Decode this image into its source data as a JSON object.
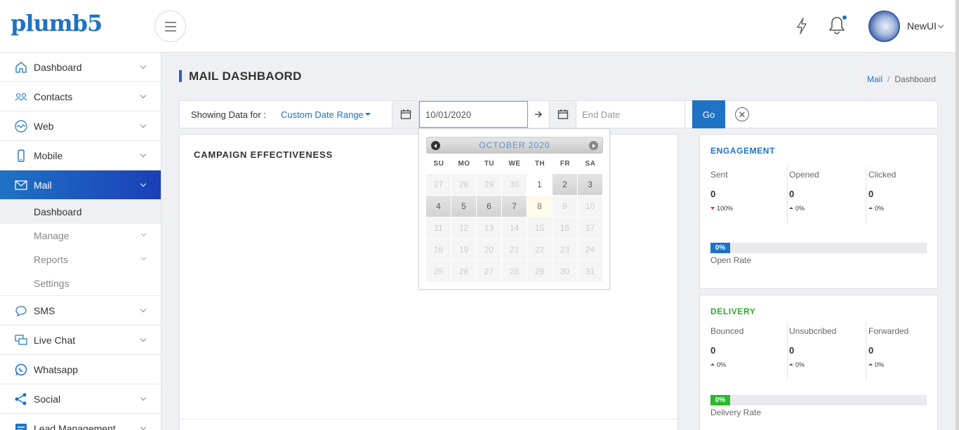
{
  "brand": {
    "logo_text": "plumb5",
    "accent": "#1e73c4",
    "active_gradient_end": "#1b3fb8"
  },
  "header": {
    "menu_icon": "hamburger-icon",
    "quick_icon": "lightning-icon",
    "notification_icon": "bell-icon",
    "user_name": "NewUI"
  },
  "sidebar": {
    "items": [
      {
        "label": "Dashboard",
        "icon": "home-icon"
      },
      {
        "label": "Contacts",
        "icon": "contacts-icon"
      },
      {
        "label": "Web",
        "icon": "web-icon"
      },
      {
        "label": "Mobile",
        "icon": "mobile-icon"
      },
      {
        "label": "Mail",
        "icon": "mail-icon"
      },
      {
        "label": "SMS",
        "icon": "chat-bubble-icon"
      },
      {
        "label": "Live Chat",
        "icon": "live-chat-icon"
      },
      {
        "label": "Whatsapp",
        "icon": "whatsapp-icon"
      },
      {
        "label": "Social",
        "icon": "share-icon"
      },
      {
        "label": "Lead Management",
        "icon": "lead-management-icon"
      }
    ],
    "mail_sub": [
      {
        "label": "Dashboard"
      },
      {
        "label": "Manage"
      },
      {
        "label": "Reports"
      },
      {
        "label": "Settings"
      }
    ]
  },
  "page": {
    "title": "MAIL DASHBAORD",
    "breadcrumb": {
      "parent": "Mail",
      "separator": "/",
      "current": "Dashboard"
    }
  },
  "filter": {
    "label": "Showing Data for :",
    "range_label": "Custom Date Range",
    "start_date": "10/01/2020",
    "end_placeholder": "End Date",
    "go_label": "Go",
    "clear_symbol": "✕"
  },
  "campaign": {
    "title": "CAMPAIGN EFFECTIVENESS"
  },
  "engagement": {
    "title": "ENGAGEMENT",
    "title_color": "#1e73c4",
    "metrics": [
      {
        "label": "Sent",
        "value": "0",
        "change": "100%",
        "direction": "down"
      },
      {
        "label": "Opened",
        "value": "0",
        "change": "0%",
        "direction": "up"
      },
      {
        "label": "Clicked",
        "value": "0",
        "change": "0%",
        "direction": "up"
      }
    ],
    "rate": {
      "value_text": "0%",
      "value": 0,
      "label": "Open Rate",
      "color": "#1e73c4"
    }
  },
  "delivery": {
    "title": "DELIVERY",
    "title_color": "#2fa82f",
    "metrics": [
      {
        "label": "Bounced",
        "value": "0",
        "change": "0%",
        "direction": "up"
      },
      {
        "label": "Unsubcribed",
        "value": "0",
        "change": "0%",
        "direction": "up"
      },
      {
        "label": "Forwarded",
        "value": "0",
        "change": "0%",
        "direction": "up"
      }
    ],
    "rate": {
      "value_text": "0%",
      "value": 0,
      "label": "Delivery Rate",
      "color": "#2db82d"
    }
  },
  "calendar": {
    "month": "OCTOBER 2020",
    "days_of_week": [
      "SU",
      "MO",
      "TU",
      "WE",
      "TH",
      "FR",
      "SA"
    ],
    "cells": [
      {
        "n": "27",
        "s": "off"
      },
      {
        "n": "28",
        "s": "off"
      },
      {
        "n": "29",
        "s": "off"
      },
      {
        "n": "30",
        "s": "off"
      },
      {
        "n": "1",
        "s": "enabled"
      },
      {
        "n": "2",
        "s": "range"
      },
      {
        "n": "3",
        "s": "range"
      },
      {
        "n": "4",
        "s": "range"
      },
      {
        "n": "5",
        "s": "range"
      },
      {
        "n": "6",
        "s": "range"
      },
      {
        "n": "7",
        "s": "range"
      },
      {
        "n": "8",
        "s": "today"
      },
      {
        "n": "9",
        "s": "off"
      },
      {
        "n": "10",
        "s": "off"
      },
      {
        "n": "11",
        "s": "off"
      },
      {
        "n": "12",
        "s": "off"
      },
      {
        "n": "13",
        "s": "off"
      },
      {
        "n": "14",
        "s": "off"
      },
      {
        "n": "15",
        "s": "off"
      },
      {
        "n": "16",
        "s": "off"
      },
      {
        "n": "17",
        "s": "off"
      },
      {
        "n": "18",
        "s": "off"
      },
      {
        "n": "19",
        "s": "off"
      },
      {
        "n": "20",
        "s": "off"
      },
      {
        "n": "21",
        "s": "off"
      },
      {
        "n": "22",
        "s": "off"
      },
      {
        "n": "23",
        "s": "off"
      },
      {
        "n": "24",
        "s": "off"
      },
      {
        "n": "25",
        "s": "off"
      },
      {
        "n": "26",
        "s": "off"
      },
      {
        "n": "27",
        "s": "off"
      },
      {
        "n": "28",
        "s": "off"
      },
      {
        "n": "29",
        "s": "off"
      },
      {
        "n": "30",
        "s": "off"
      },
      {
        "n": "31",
        "s": "off"
      }
    ]
  }
}
